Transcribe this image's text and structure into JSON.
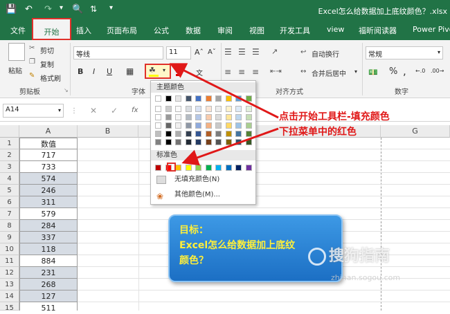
{
  "window": {
    "title": "Excel怎么给数据加上底纹颜色？.xlsx"
  },
  "tabs": [
    "文件",
    "开始",
    "插入",
    "页面布局",
    "公式",
    "数据",
    "审阅",
    "视图",
    "开发工具",
    "view",
    "福昕阅读器",
    "Power Pivo"
  ],
  "ribbon": {
    "paste_label": "粘贴",
    "cut_label": "剪切",
    "copy_label": "复制",
    "format_painter_label": "格式刷",
    "clipboard_group": "剪贴板",
    "font_name": "等线",
    "font_size": "11",
    "font_group": "字体",
    "bold": "B",
    "italic": "I",
    "underline": "U",
    "align_group": "对齐方式",
    "wrap_text": "自动换行",
    "merge_center": "合并后居中",
    "number_format": "常规",
    "number_group": "数字",
    "percent": "%",
    "comma": ","
  },
  "formula_bar": {
    "name_box": "A14",
    "fx": "fx"
  },
  "columns": [
    "A",
    "B",
    "G"
  ],
  "column_a_header": "数值",
  "rows": [
    "1",
    "2",
    "3",
    "4",
    "5",
    "6",
    "7",
    "8",
    "9",
    "10",
    "11",
    "12",
    "13",
    "14",
    "15"
  ],
  "values": [
    "717",
    "733",
    "574",
    "246",
    "311",
    "579",
    "284",
    "337",
    "118",
    "884",
    "231",
    "268",
    "127",
    "511"
  ],
  "dropdown": {
    "theme_colors_label": "主题颜色",
    "standard_colors_label": "标准色",
    "no_fill_label": "无填充颜色(N)",
    "more_colors_label": "其他颜色(M)...",
    "theme_colors": [
      "#ffffff",
      "#000000",
      "#e7e6e6",
      "#44546a",
      "#4472c4",
      "#ed7d31",
      "#a5a5a5",
      "#ffc000",
      "#5b9bd5",
      "#70ad47"
    ],
    "standard_colors": [
      "#c00000",
      "#ff0000",
      "#ffc000",
      "#ffff00",
      "#92d050",
      "#00b050",
      "#00b0f0",
      "#0070c0",
      "#002060",
      "#7030a0"
    ]
  },
  "annotation": {
    "line1": "点击开始工具栏-填充颜色",
    "line2": "下拉菜单中的红色"
  },
  "callout": {
    "line1": "目标：",
    "line2": "Excel怎么给数据加上底纹",
    "line3": "颜色？"
  },
  "watermark": {
    "text": "搜狗指南",
    "url": "zhinan.sogou.com"
  },
  "colors": {
    "excel_green": "#217346",
    "highlight_red": "#e0302a",
    "shaded_cell": "#d6dce4"
  }
}
